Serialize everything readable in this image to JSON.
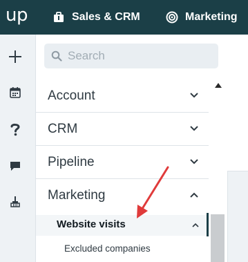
{
  "topbar": {
    "logo": "up",
    "nav": [
      {
        "label": "Sales & CRM",
        "icon": "briefcase-icon"
      },
      {
        "label": "Marketing",
        "icon": "target-icon"
      }
    ]
  },
  "rail": {
    "icons": [
      "plus-icon",
      "calendar-icon",
      "help-icon",
      "chat-icon",
      "broom-icon"
    ]
  },
  "search": {
    "placeholder": "Search",
    "value": ""
  },
  "menu": {
    "items": [
      {
        "label": "Account",
        "expanded": false
      },
      {
        "label": "CRM",
        "expanded": false
      },
      {
        "label": "Pipeline",
        "expanded": false
      },
      {
        "label": "Marketing",
        "expanded": true
      }
    ],
    "sub_item": {
      "label": "Website visits",
      "expanded": true
    },
    "sub_sub_item": {
      "label": "Excluded companies"
    }
  },
  "colors": {
    "topbar": "#1b3f47",
    "rail": "#eef2f5",
    "annotation_arrow": "#e03b3b"
  }
}
